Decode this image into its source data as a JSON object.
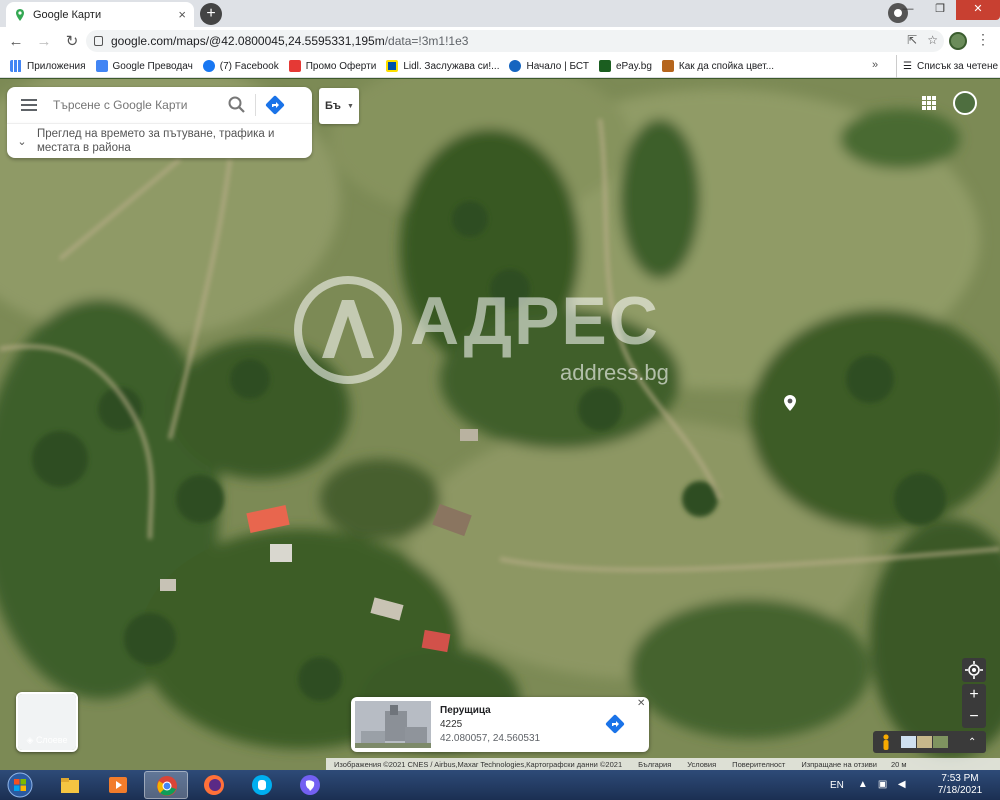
{
  "browser": {
    "tab_title": "Google Карти",
    "tab_close": "×",
    "new_tab": "+",
    "url_main": "google.com/maps/@42.0800045,24.5595331,195m",
    "url_tail": "/data=!3m1!1e3",
    "window_controls": [
      "—",
      "❐",
      "✕"
    ]
  },
  "bookmarks": {
    "items": [
      {
        "label": "Приложения",
        "color": "#4285f4"
      },
      {
        "label": "Google Преводач",
        "color": "#4285f4"
      },
      {
        "label": "(7) Facebook",
        "color": "#1877f2"
      },
      {
        "label": "Промо Оферти",
        "color": "#e53935"
      },
      {
        "label": "Lidl. Заслужава си!...",
        "color": "#0050aa"
      },
      {
        "label": "Начало | БСТ",
        "color": "#1565c0"
      },
      {
        "label": "ePay.bg",
        "color": "#1b5e20"
      },
      {
        "label": "Как да спойка цвет...",
        "color": "#b5651d"
      }
    ],
    "more": "»",
    "reading_list": "Списък за четене"
  },
  "maps": {
    "search_placeholder": "Търсене с Google Карти",
    "sub_text": "Преглед на времето за пътуване, трафика и местата в района",
    "lang_label": "Бъ",
    "watermark_text": "АДРЕС",
    "watermark_sub": "address.bg",
    "layers_label": "Слоеве",
    "place": {
      "name": "Перущица",
      "code": "4225",
      "coords": "42.080057, 24.560531"
    },
    "zoom_in": "+",
    "zoom_out": "−",
    "attribution": [
      "Изображения ©2021 CNES / Airbus,Maxar Technologies,Картографски данни ©2021",
      "България",
      "Условия",
      "Поверителност",
      "Изпращане на отзиви",
      "20 м"
    ]
  },
  "taskbar": {
    "lang": "EN",
    "time": "7:53 PM",
    "date": "7/18/2021"
  }
}
